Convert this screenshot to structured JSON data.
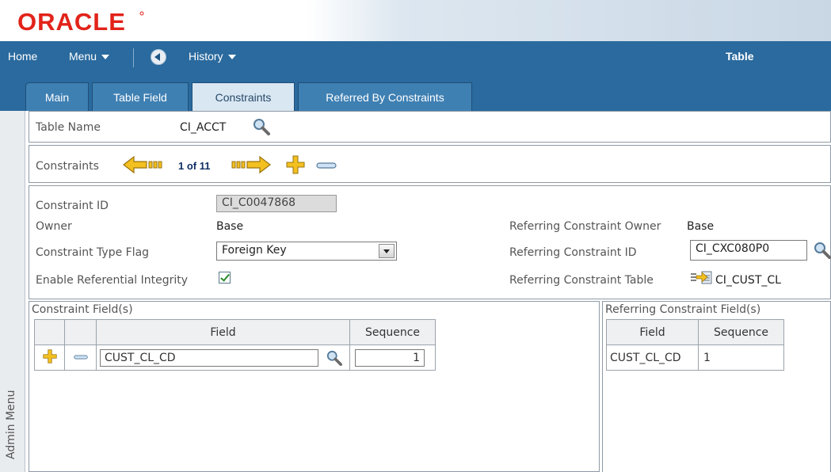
{
  "brand": {
    "logo_text": "ORACLE",
    "color": "#e2231a"
  },
  "nav": {
    "home": "Home",
    "menu": "Menu",
    "history": "History",
    "page_title": "Table",
    "bar_color": "#2a6a9e"
  },
  "tabs": [
    {
      "label": "Main",
      "active": false
    },
    {
      "label": "Table Field",
      "active": false
    },
    {
      "label": "Constraints",
      "active": true
    },
    {
      "label": "Referred By Constraints",
      "active": false
    }
  ],
  "side_menu": {
    "label": "Admin Menu"
  },
  "table_name": {
    "label": "Table Name",
    "value": "CI_ACCT"
  },
  "constraints_nav": {
    "label": "Constraints",
    "counter": "1 of 11"
  },
  "fields": {
    "constraint_id_label": "Constraint ID",
    "constraint_id_value": "CI_C0047868",
    "owner_label": "Owner",
    "owner_value": "Base",
    "type_flag_label": "Constraint Type Flag",
    "type_flag_value": "Foreign Key",
    "enable_ri_label": "Enable Referential Integrity",
    "enable_ri_checked": true,
    "ref_owner_label": "Referring Constraint Owner",
    "ref_owner_value": "Base",
    "ref_id_label": "Referring Constraint ID",
    "ref_id_value": "CI_CXC080P0",
    "ref_table_label": "Referring Constraint Table",
    "ref_table_value": "CI_CUST_CL"
  },
  "constraint_fields": {
    "title": "Constraint Field(s)",
    "columns": [
      "Field",
      "Sequence"
    ],
    "rows": [
      {
        "field": "CUST_CL_CD",
        "sequence": "1"
      }
    ]
  },
  "referring_fields": {
    "title": "Referring Constraint Field(s)",
    "columns": [
      "Field",
      "Sequence"
    ],
    "rows": [
      {
        "field": "CUST_CL_CD",
        "sequence": "1"
      }
    ]
  }
}
